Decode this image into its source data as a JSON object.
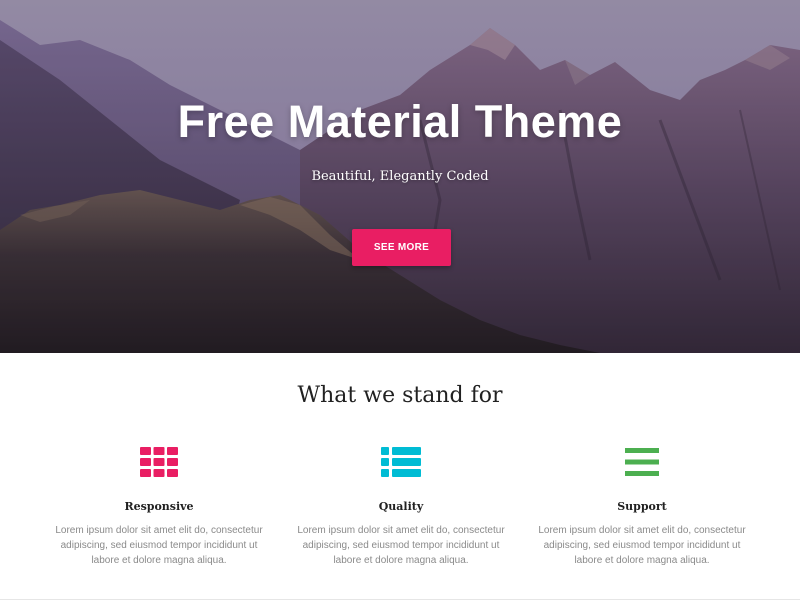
{
  "hero": {
    "title": "Free Material Theme",
    "subtitle": "Beautiful, Elegantly Coded",
    "button_label": "SEE MORE"
  },
  "features": {
    "title": "What we stand for",
    "items": [
      {
        "title": "Responsive",
        "text": "Lorem ipsum dolor sit amet elit do, consectetur adipiscing, sed eiusmod tempor incididunt ut labore et dolore magna aliqua.",
        "icon": "grid-icon",
        "color": "#e91e63"
      },
      {
        "title": "Quality",
        "text": "Lorem ipsum dolor sit amet elit do, consectetur adipiscing, sed eiusmod tempor incididunt ut labore et dolore magna aliqua.",
        "icon": "list-icon",
        "color": "#00bcd4"
      },
      {
        "title": "Support",
        "text": "Lorem ipsum dolor sit amet elit do, consectetur adipiscing, sed eiusmod tempor incididunt ut labore et dolore magna aliqua.",
        "icon": "menu-icon",
        "color": "#4caf50"
      }
    ]
  },
  "colors": {
    "accent": "#e91e63",
    "cyan": "#00bcd4",
    "green": "#4caf50"
  }
}
